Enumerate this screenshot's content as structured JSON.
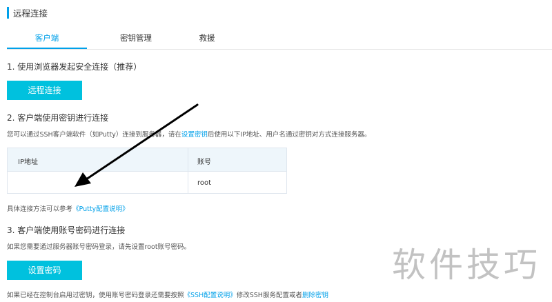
{
  "header": {
    "title": "远程连接"
  },
  "tabs": [
    {
      "label": "客户端",
      "active": true
    },
    {
      "label": "密钥管理",
      "active": false
    },
    {
      "label": "救援",
      "active": false
    }
  ],
  "section1": {
    "heading": "1. 使用浏览器发起安全连接（推荐）",
    "button": "远程连接"
  },
  "section2": {
    "heading": "2. 客户端使用密钥进行连接",
    "desc_before": "您可以通过SSH客户端软件（如Putty）连接到服务器，请在",
    "desc_link": "设置密钥",
    "desc_after": "后使用以下IP地址、用户名通过密钥对方式连接服务器。",
    "table": {
      "columns": [
        "IP地址",
        "账号"
      ],
      "rows": [
        [
          "",
          "root"
        ]
      ]
    },
    "ref_text": "具体连接方法可以参考",
    "ref_link": "《Putty配置说明》"
  },
  "section3": {
    "heading": "3. 客户端使用账号密码进行连接",
    "desc": "如果您需要通过服务器账号密码登录，请先设置root账号密码。",
    "button": "设置密码",
    "note_before": "如果已经在控制台启用过密钥，使用账号密码登录还需要按照",
    "note_link1": "《SSH配置说明》",
    "note_middle": "修改SSH服务配置或者",
    "note_link2": "删除密钥"
  },
  "watermark": "软件技巧",
  "colors": {
    "accent": "#00a0e9",
    "button": "#00c1de",
    "table_header": "#eef6fb"
  }
}
